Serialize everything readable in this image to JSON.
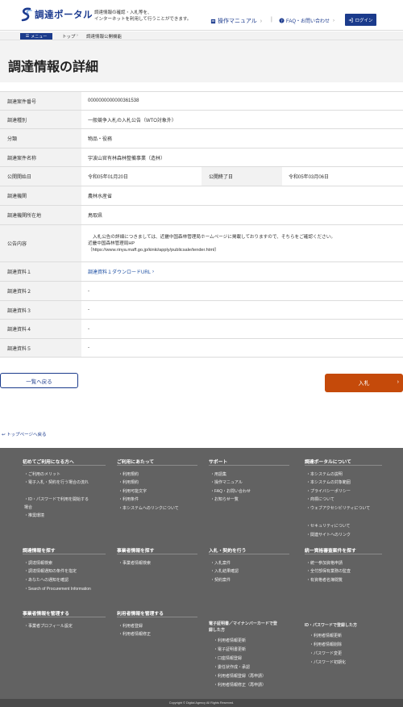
{
  "header": {
    "logo_text": "調達ポータル",
    "tagline_1": "調達情報の確認・入札等を、",
    "tagline_2": "インターネットを利用して行うことができます。",
    "manual_link": "操作マニュアル",
    "faq_link": "FAQ・お問い合わせ",
    "login_label": "ログイン"
  },
  "crumbs": {
    "menu_label": "メニュー",
    "top": "トップ",
    "current": "調達情報公開機能"
  },
  "page_title": "調達情報の詳細",
  "detail": {
    "case_no_label": "調達案件番号",
    "case_no": "0000000000000361538",
    "type_label": "調達種別",
    "type": "一般競争入札の入札公告（WTO対象外）",
    "category_label": "分類",
    "category": "物品・役務",
    "name_label": "調達案件名称",
    "name": "宇波山官有林森林整備事業（造林）",
    "start_label": "公開開始日",
    "start": "令和05年01月20日",
    "end_label": "公開終了日",
    "end": "令和05年03月06日",
    "agency_label": "調達機関",
    "agency": "農林水産省",
    "location_label": "調達機関所在地",
    "location": "鳥取県",
    "notice_label": "公告内容",
    "notice_1": "入札公告の詳細につきましては、近畿中国森林管理局ホームページに掲載しておりますので、そちらをご確認ください。",
    "notice_2": "近畿中国森林管理局HP",
    "notice_3": "（https://www.rinya.maff.go.jp/kinki/apply/publicsale/tender.html）",
    "doc1_label": "調達資料１",
    "doc1": "調達資料１ダウンロードURL",
    "doc2_label": "調達資料２",
    "doc2": "-",
    "doc3_label": "調達資料３",
    "doc3": "-",
    "doc4_label": "調達資料４",
    "doc4": "-",
    "doc5_label": "調達資料５",
    "doc5": "-"
  },
  "buttons": {
    "back": "一覧へ戻る",
    "bid": "入札",
    "to_top": "トップページへ戻る"
  },
  "footer": {
    "col1_head": "初めてご利用になる方へ",
    "col1_items": [
      "ご利用のメリット",
      "電子入札・契約を行う場合の流れ",
      "ID・パスワードで利用を開始する",
      "場合",
      "推奨環境"
    ],
    "col2_head": "ご利用にあたって",
    "col2_items": [
      "利用規約",
      "利用規約",
      "利用可能文字",
      "利用条件",
      "本システムへのリンクについて"
    ],
    "col3_head": "サポート",
    "col3_items": [
      "用語集",
      "操作マニュアル",
      "FAQ・お問い合わせ",
      "お知らせ一覧"
    ],
    "col4_head": "調達ポータルについて",
    "col4_items": [
      "本システムの説明",
      "本システムの対象範囲",
      "プライバシーポリシー",
      "商標について",
      "ウェブアクセシビリティについて",
      "セキュリティについて",
      "関連サイトへのリンク"
    ],
    "row2_col1_head": "調達情報を探す",
    "row2_col1_items": [
      "調達情報検索",
      "調達情報通知の条件を指定",
      "あなたへの通知を確認",
      "Search of Procurement Information"
    ],
    "row2_col2_head": "事業者情報を探す",
    "row2_col2_items": [
      "事業者情報検索"
    ],
    "row2_col3_head": "入札・契約を行う",
    "row2_col3_items": [
      "入札案件",
      "入札結果確認",
      "契約案件"
    ],
    "row2_col4_head": "統一資格審査案件を探す",
    "row2_col4_items": [
      "統一参加資格申請",
      "全付部保有業務の監査",
      "有資格者名簿閲覧"
    ],
    "row3_col1_head": "事業者情報を管理する",
    "row3_col1_items": [
      "事業者プロフィール設定"
    ],
    "row3_col2_head": "利用者情報を管理する",
    "row3_col2_items": [
      "利用者登録",
      "利用者情報修正"
    ],
    "row3_col3_head_1": "電子証明書／マイナンバーカードで登",
    "row3_col3_head_2": "録した方",
    "row3_col3_items": [
      "利用者情報更新",
      "電子証明書更新",
      "口座情報登録",
      "委任状作成・承認",
      "利用者情報登録（再申請）",
      "利用者情報修正（再申請）"
    ],
    "row3_col4_head": "ID・パスワードで登録した方",
    "row3_col4_items": [
      "利用者情報更新",
      "利用者情報削除",
      "パスワード変更",
      "パスワード初期化"
    ],
    "copyright": "Copyright © Digital Agency All Rights Reserved."
  }
}
